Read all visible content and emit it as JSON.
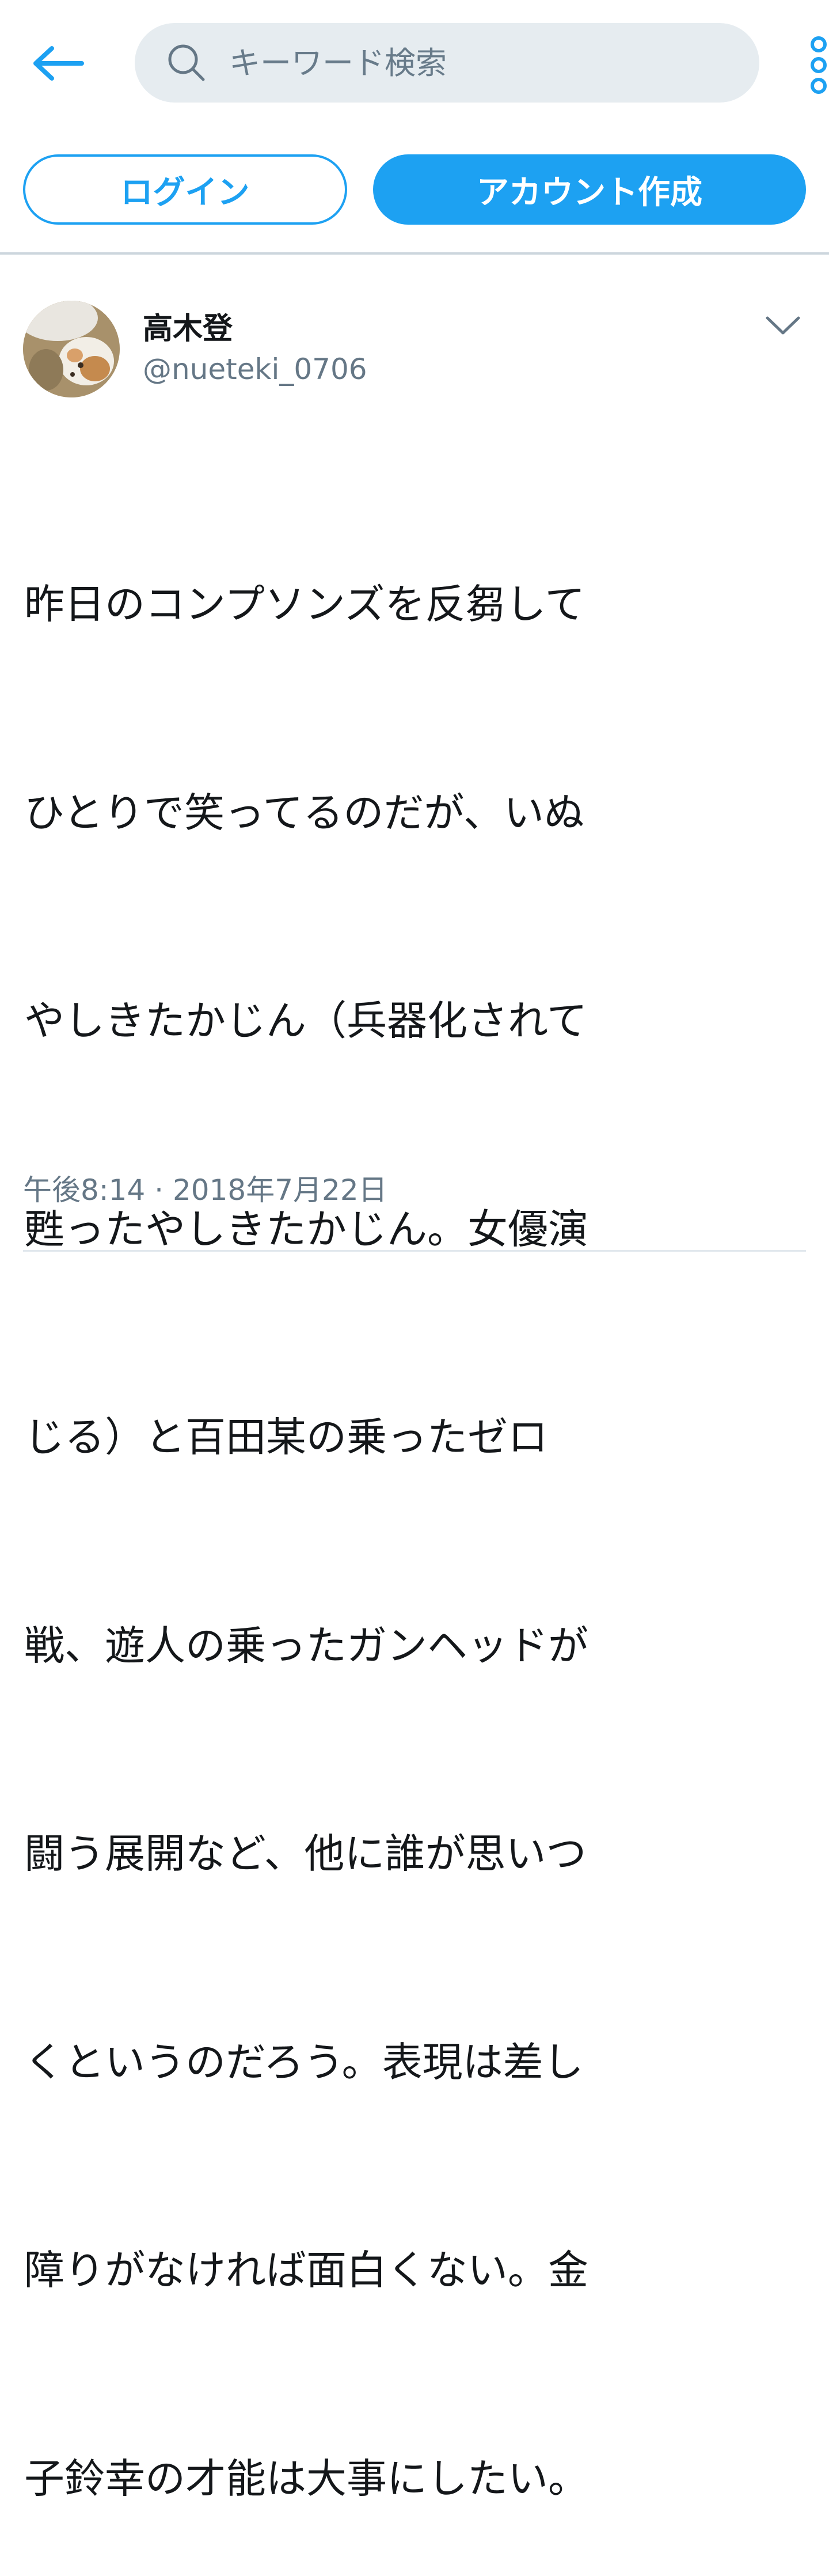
{
  "search": {
    "placeholder": "キーワード検索"
  },
  "auth": {
    "login_label": "ログイン",
    "signup_label": "アカウント作成"
  },
  "tweet": {
    "display_name": "高木登",
    "handle": "@nueteki_0706",
    "text_lines": [
      "昨日のコンプソンズを反芻して",
      "ひとりで笑ってるのだが、いぬ",
      "やしきたかじん（兵器化されて",
      "甦ったやしきたかじん。女優演",
      "じる）と百田某の乗ったゼロ",
      "戦、遊人の乗ったガンヘッドが",
      "闘う展開など、他に誰が思いつ",
      "くというのだろう。表現は差し",
      "障りがなければ面白くない。金",
      "子鈴幸の才能は大事にしたい。"
    ],
    "timestamp": "午後8:14 · 2018年7月22日"
  },
  "icons": {
    "back": "arrow-left-icon",
    "search": "search-icon",
    "more": "more-vertical-icon",
    "caret": "chevron-down-icon"
  },
  "colors": {
    "accent": "#1da1f2",
    "secondary_text": "#657786",
    "search_bg": "#e6ecf0"
  }
}
